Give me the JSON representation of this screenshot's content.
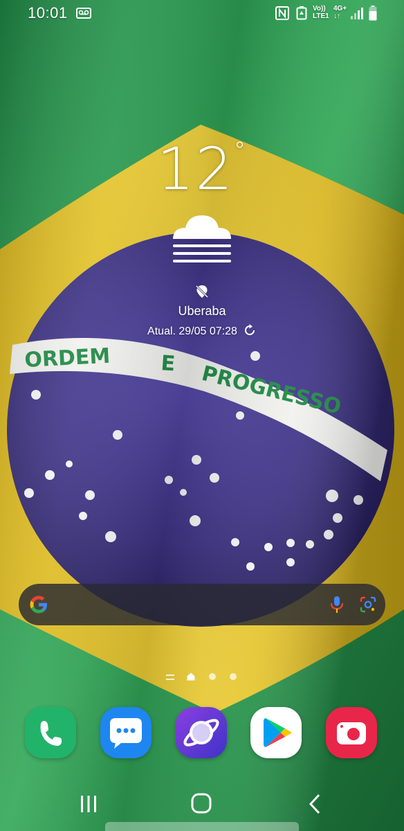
{
  "status_bar": {
    "time": "10:01",
    "volte_top": "Vo))",
    "volte_bottom": "LTE1",
    "network_type": "4G+",
    "network_arrows": "↓↑",
    "icons": [
      "voicemail-icon",
      "nfc-icon",
      "battery-saver-icon",
      "signal-icon",
      "battery-icon"
    ]
  },
  "weather": {
    "temperature": "12",
    "degree": "°",
    "condition_icon": "fog-icon",
    "location_icon": "location-off-icon",
    "city": "Uberaba",
    "updated": "Atual. 29/05 07:28",
    "refresh_icon": "refresh-icon"
  },
  "search_bar": {
    "icons": [
      "google-icon",
      "mic-icon",
      "lens-icon"
    ]
  },
  "page_indicator": {
    "pages": 3,
    "current": "home"
  },
  "dock": {
    "apps": [
      {
        "name": "phone",
        "color": "#22b36a"
      },
      {
        "name": "messages",
        "color": "#1e86f0"
      },
      {
        "name": "internet",
        "color": "#6a3be0"
      },
      {
        "name": "play-store",
        "color": "#ffffff"
      },
      {
        "name": "camera",
        "color": "#e8264a"
      }
    ]
  },
  "nav_bar": {
    "icons": [
      "recent-apps-icon",
      "home-icon",
      "back-icon"
    ]
  },
  "wallpaper": {
    "description_colors": {
      "green": "#2e9b4f",
      "yellow": "#e9c82c",
      "blue": "#3a2f7d",
      "white": "#f2f2f2"
    },
    "motto": "ORDEM E PROGRESSO"
  }
}
